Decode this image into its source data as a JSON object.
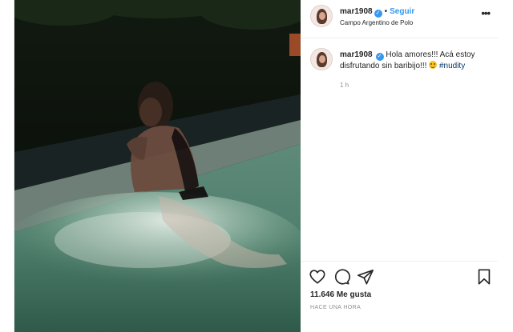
{
  "header": {
    "username": "mar1908",
    "follow_label": "Seguir",
    "location": "Campo Argentino de Polo",
    "more_label": "•••"
  },
  "caption": {
    "username": "mar1908",
    "text": "Hola amores!!! Acá estoy disfrutando sin baribijo!!!",
    "hashtag": "#nudity",
    "time_ago": "1 h"
  },
  "actions": {
    "icons": [
      "heart-icon",
      "comment-icon",
      "share-icon",
      "bookmark-icon"
    ],
    "likes": "11.646 Me gusta",
    "timestamp": "HACE UNA HORA"
  },
  "colors": {
    "link_blue": "#3897f0",
    "hashtag_blue": "#00376b",
    "verified_blue": "#3897f0",
    "secondary_text": "#8e8e8e"
  }
}
